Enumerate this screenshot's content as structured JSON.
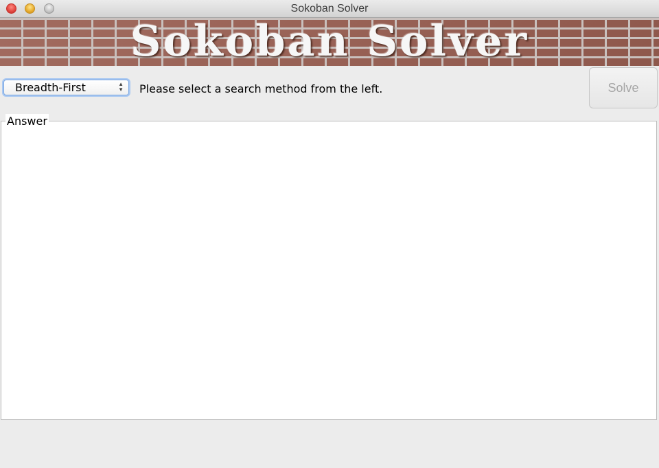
{
  "window": {
    "title": "Sokoban Solver"
  },
  "banner": {
    "text": "Sokoban Solver"
  },
  "controls": {
    "search_method": {
      "selected": "Breadth-First"
    },
    "status_text": "Please select a search method from the left.",
    "solve_label": "Solve",
    "solve_enabled": false
  },
  "answer": {
    "label": "Answer",
    "content": ""
  },
  "icons": {
    "close": "close-icon",
    "minimize": "minimize-icon",
    "zoom": "zoom-icon",
    "select_arrows": "up-down-arrows-icon"
  }
}
